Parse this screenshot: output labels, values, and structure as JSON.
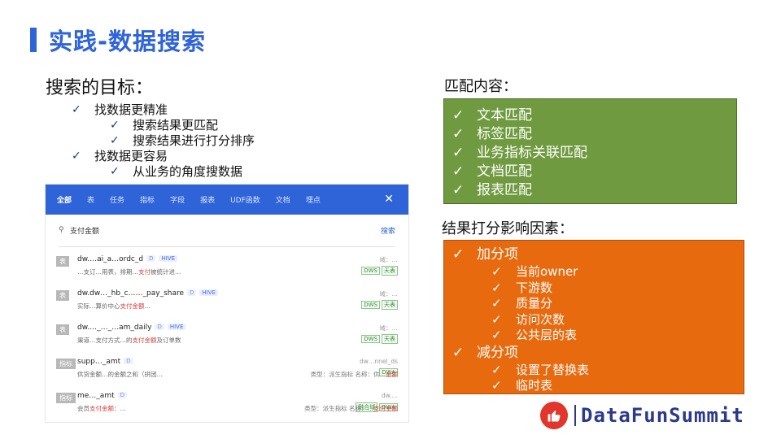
{
  "slide": {
    "title": "实践-数据搜索"
  },
  "goals": {
    "heading": "搜索的目标：",
    "items": [
      {
        "text": "找数据更精准",
        "level": 1
      },
      {
        "text": "搜索结果更匹配",
        "level": 2
      },
      {
        "text": "搜索结果进行打分排序",
        "level": 2
      },
      {
        "text": "找数据更容易",
        "level": 1
      },
      {
        "text": "从业务的角度搜数据",
        "level": 2
      }
    ]
  },
  "search_panel": {
    "tabs": [
      "全部",
      "表",
      "任务",
      "指标",
      "字段",
      "报表",
      "UDF函数",
      "文档",
      "埋点"
    ],
    "active_tab": "全部",
    "close_icon": "close-icon",
    "query": "支付金额",
    "search_button": "搜索",
    "results": [
      {
        "kind": "表",
        "name": "dw.…ai_a…ordc_d",
        "tag": "D",
        "engine": "HIVE",
        "desc_pre": "…支订…用表，排期…",
        "desc_hl": "支付",
        "desc_post": "被统计进…",
        "right_top": "域：…",
        "right_tags": [
          "DWS",
          "天表"
        ],
        "meta_pre": "",
        "meta_hl": ""
      },
      {
        "kind": "表",
        "name": "dw.dw…_hb_c……_pay_share",
        "tag": "D",
        "engine": "HIVE",
        "desc_pre": "实际…算价中心",
        "desc_hl": "支付金额",
        "desc_post": "…",
        "right_top": "域：…",
        "right_tags": [
          "DWS",
          "天表"
        ],
        "meta_pre": "",
        "meta_hl": ""
      },
      {
        "kind": "表",
        "name": "dw.…_…_…am_daily",
        "tag": "D",
        "engine": "HIVE",
        "desc_pre": "渠道…支付方式…的",
        "desc_hl": "支付金额",
        "desc_post": "及订单数",
        "right_top": "域：…",
        "right_tags": [
          "DWS",
          "天表"
        ],
        "meta_pre": "",
        "meta_hl": ""
      },
      {
        "kind": "指标",
        "name": "supp…_amt",
        "tag": "D",
        "engine": "",
        "desc_pre": "供货金额…的金额之和（拼团…",
        "desc_hl": "",
        "desc_post": "",
        "right_top": "dw…nnel_ds",
        "right_tags": [
          "DWA"
        ],
        "meta_pre": "类型：派生指标 名称：供…",
        "meta_hl": "金额"
      },
      {
        "kind": "指标",
        "name": "me…_amt",
        "tag": "D",
        "engine": "",
        "desc_pre": "会员",
        "desc_hl": "支付金额",
        "desc_post": "：…",
        "right_top": "dw.…",
        "right_tags": [
          "融合域",
          "DWA"
        ],
        "meta_pre": "类型：派生指标 名称：…",
        "meta_hl": "支付金额"
      }
    ]
  },
  "match": {
    "heading": "匹配内容：",
    "items": [
      "文本匹配",
      "标签匹配",
      "业务指标关联匹配",
      "文档匹配",
      "报表匹配"
    ],
    "box_color": "#6f9a3f"
  },
  "score": {
    "heading": "结果打分影响因素：",
    "groups": [
      {
        "label": "加分项",
        "items": [
          "当前owner",
          "下游数",
          "质量分",
          "访问次数",
          "公共层的表"
        ]
      },
      {
        "label": "减分项",
        "items": [
          "设置了替换表",
          "临时表"
        ]
      }
    ],
    "box_color": "#e86a0f"
  },
  "footer": {
    "brand": "DataFunSummit",
    "logo_icon": "thumbs-up-icon"
  },
  "colors": {
    "accent": "#2f64d8",
    "brand": "#2b3a8a",
    "logo_red": "#e2352b"
  }
}
